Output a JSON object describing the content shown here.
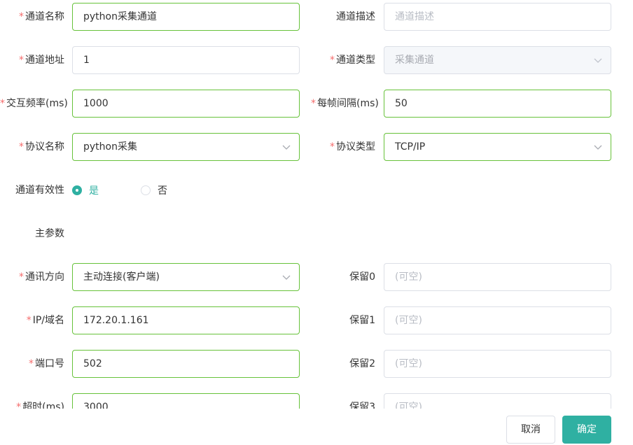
{
  "form": {
    "channel_name": {
      "label": "通道名称",
      "value": "python采集通道"
    },
    "channel_desc": {
      "label": "通道描述",
      "placeholder": "通道描述"
    },
    "channel_address": {
      "label": "通道地址",
      "value": "1"
    },
    "channel_type": {
      "label": "通道类型",
      "value": "采集通道"
    },
    "interact_freq": {
      "label": "交互频率(ms)",
      "value": "1000"
    },
    "frame_interval": {
      "label": "每帧间隔(ms)",
      "value": "50"
    },
    "protocol_name": {
      "label": "协议名称",
      "value": "python采集"
    },
    "protocol_type": {
      "label": "协议类型",
      "value": "TCP/IP"
    },
    "validity": {
      "label": "通道有效性",
      "options": [
        "是",
        "否"
      ],
      "selected": "是"
    },
    "main_params_heading": "主参数",
    "comm_direction": {
      "label": "通讯方向",
      "value": "主动连接(客户端)"
    },
    "ip_domain": {
      "label": "IP/域名",
      "value": "172.20.1.161"
    },
    "port": {
      "label": "端口号",
      "value": "502"
    },
    "timeout": {
      "label": "超时(ms)",
      "value": "3000"
    },
    "reserved0": {
      "label": "保留0",
      "placeholder": "(可空)"
    },
    "reserved1": {
      "label": "保留1",
      "placeholder": "(可空)"
    },
    "reserved2": {
      "label": "保留2",
      "placeholder": "(可空)"
    },
    "reserved3": {
      "label": "保留3",
      "placeholder": "(可空)"
    }
  },
  "footer": {
    "cancel_label": "取消",
    "confirm_label": "确定"
  },
  "colors": {
    "accent": "#2fb0a2",
    "required_star": "#f56c6c",
    "active_border": "#67c23a"
  },
  "icons": {
    "select_arrow": "chevron-down-icon"
  }
}
